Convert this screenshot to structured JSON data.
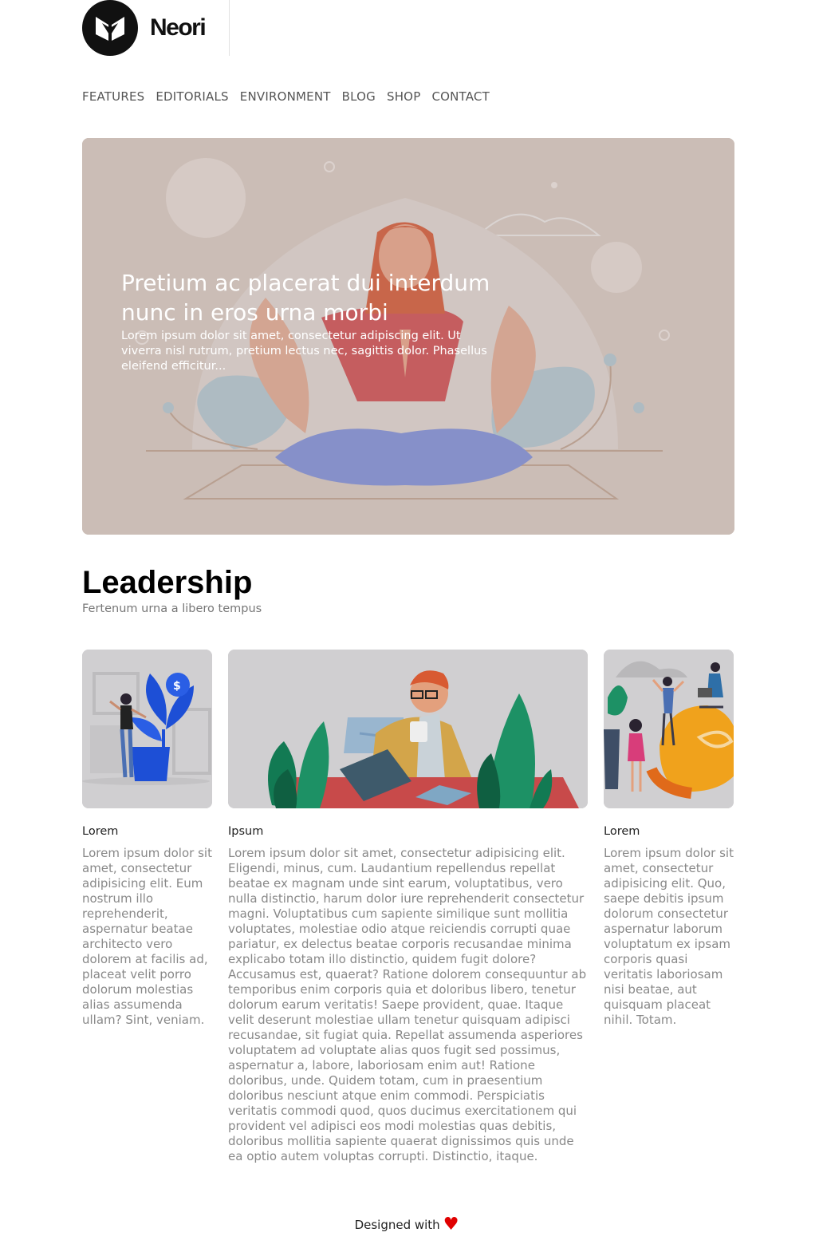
{
  "brand": {
    "name": "Neori"
  },
  "nav": {
    "items": [
      "FEATURES",
      "EDITORIALS",
      "ENVIRONMENT",
      "BLOG",
      "SHOP",
      "CONTACT"
    ]
  },
  "hero": {
    "title": "Pretium ac placerat dui interdum nunc in eros urna morbi",
    "description": "Lorem ipsum dolor sit amet, consectetur adipiscing elit. Ut viverra nisl rutrum, pretium lectus nec, sagittis dolor. Phasellus eleifend efficitur..."
  },
  "section": {
    "title": "Leadership",
    "subtitle": "Fertenum urna a libero tempus"
  },
  "cards": [
    {
      "title": "Lorem",
      "text": "Lorem ipsum dolor sit amet, consectetur adipisicing elit. Eum nostrum illo reprehenderit, aspernatur beatae architecto vero dolorem at facilis ad, placeat velit porro dolorum molestias alias assumenda ullam? Sint, veniam."
    },
    {
      "title": "Ipsum",
      "text": "Lorem ipsum dolor sit amet, consectetur adipisicing elit. Eligendi, minus, cum. Laudantium repellendus repellat beatae ex magnam unde sint earum, voluptatibus, vero nulla distinctio, harum dolor iure reprehenderit consectetur magni. Voluptatibus cum sapiente similique sunt mollitia voluptates, molestiae odio atque reiciendis corrupti quae pariatur, ex delectus beatae corporis recusandae minima explicabo totam illo distinctio, quidem fugit dolore? Accusamus est, quaerat? Ratione dolorem consequuntur ab temporibus enim corporis quia et doloribus libero, tenetur dolorum earum veritatis! Saepe provident, quae. Itaque velit deserunt molestiae ullam tenetur quisquam adipisci recusandae, sit fugiat quia. Repellat assumenda asperiores voluptatem ad voluptate alias quos fugit sed possimus, aspernatur a, labore, laboriosam enim aut! Ratione doloribus, unde. Quidem totam, cum in praesentium doloribus nesciunt atque enim commodi. Perspiciatis veritatis commodi quod, quos ducimus exercitationem qui provident vel adipisci eos modi molestias quas debitis, doloribus mollitia sapiente quaerat dignissimos quis unde ea optio autem voluptas corrupti. Distinctio, itaque."
    },
    {
      "title": "Lorem",
      "text": "Lorem ipsum dolor sit amet, consectetur adipisicing elit. Quo, saepe debitis ipsum dolorum consectetur aspernatur laborum voluptatum ex ipsam corporis quasi veritatis laboriosam nisi beatae, aut quisquam placeat nihil. Totam."
    }
  ],
  "footer": {
    "text": "Designed with",
    "icon": "heart-icon",
    "heart_color": "#e00000"
  },
  "colors": {
    "hero_bg": "#cbbdb6",
    "card_bg": "#d0cfd1"
  }
}
